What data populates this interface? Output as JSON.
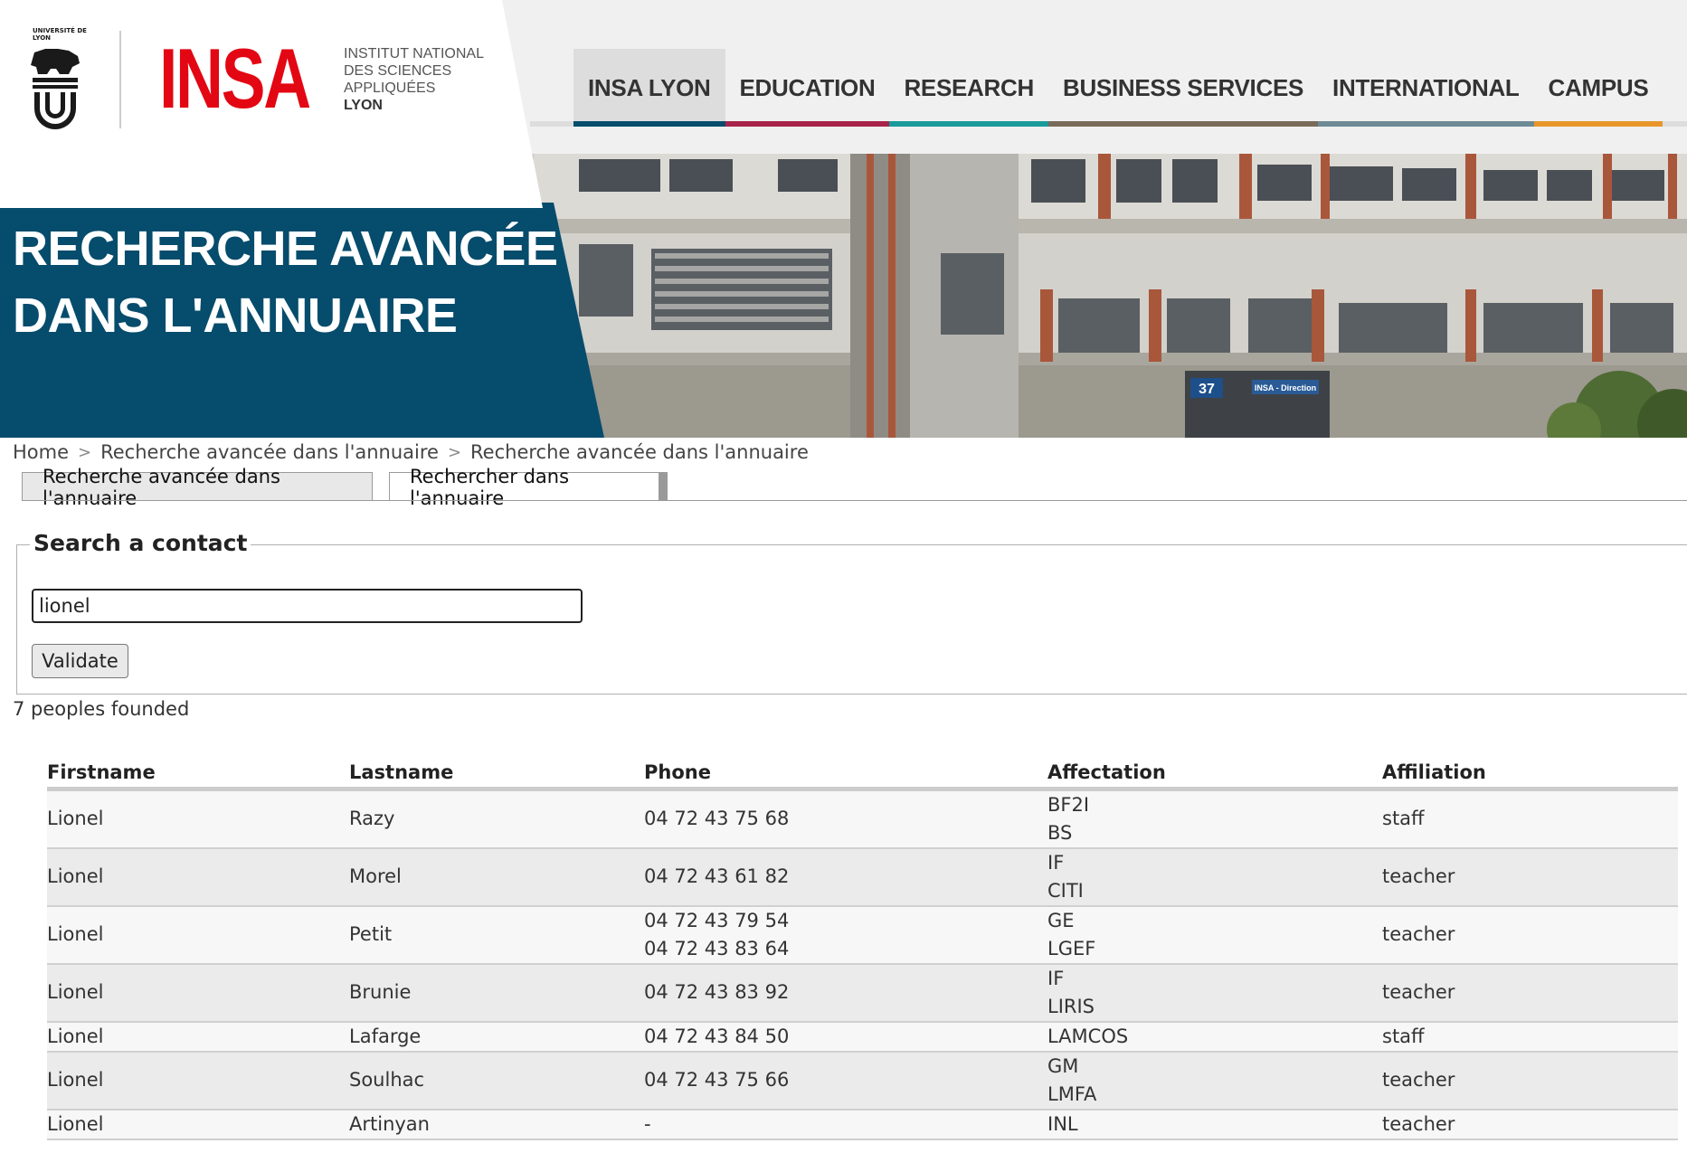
{
  "logo": {
    "university_text": "UNIVERSITÉ DE LYON",
    "brand": "INSA",
    "subtitle_lines": [
      "INSTITUT NATIONAL",
      "DES SCIENCES",
      "APPLIQUÉES"
    ],
    "subtitle_city": "LYON",
    "brand_color": "#e30613"
  },
  "nav": {
    "items": [
      {
        "label": "INSA LYON",
        "color": "#064c6c"
      },
      {
        "label": "EDUCATION",
        "color": "#a8244a"
      },
      {
        "label": "RESEARCH",
        "color": "#1a9a9a"
      },
      {
        "label": "BUSINESS SERVICES",
        "color": "#7a6a5a"
      },
      {
        "label": "INTERNATIONAL",
        "color": "#6d8a95"
      },
      {
        "label": "CAMPUS",
        "color": "#e8962a"
      }
    ]
  },
  "banner": {
    "title_lines": [
      "RECHERCHE AVANCÉE",
      "DANS L'ANNUAIRE"
    ],
    "title_bg": "#064c6c",
    "building_number": "37",
    "building_sign": "INSA - Direction"
  },
  "breadcrumb": {
    "items": [
      "Home",
      "Recherche avancée dans l'annuaire",
      "Recherche avancée dans l'annuaire"
    ],
    "separator": ">"
  },
  "tabs": {
    "advanced": "Recherche avancée dans l'annuaire",
    "search": "Rechercher dans l'annuaire"
  },
  "search": {
    "legend": "Search a contact",
    "value": "lionel",
    "button_label": "Validate"
  },
  "results": {
    "count_text": "7 peoples founded",
    "columns": [
      "Firstname",
      "Lastname",
      "Phone",
      "Affectation",
      "Affiliation"
    ],
    "rows": [
      {
        "firstname": "Lionel",
        "lastname": "Razy",
        "phones": [
          "04 72 43 75 68"
        ],
        "affectations": [
          "BF2I",
          "BS"
        ],
        "affiliation": "staff"
      },
      {
        "firstname": "Lionel",
        "lastname": "Morel",
        "phones": [
          "04 72 43 61 82"
        ],
        "affectations": [
          "IF",
          "CITI"
        ],
        "affiliation": "teacher"
      },
      {
        "firstname": "Lionel",
        "lastname": "Petit",
        "phones": [
          "04 72 43 79 54",
          "04 72 43 83 64"
        ],
        "affectations": [
          "GE",
          "LGEF"
        ],
        "affiliation": "teacher"
      },
      {
        "firstname": "Lionel",
        "lastname": "Brunie",
        "phones": [
          "04 72 43 83 92"
        ],
        "affectations": [
          "IF",
          "LIRIS"
        ],
        "affiliation": "teacher"
      },
      {
        "firstname": "Lionel",
        "lastname": "Lafarge",
        "phones": [
          "04 72 43 84 50"
        ],
        "affectations": [
          "LAMCOS"
        ],
        "affiliation": "staff"
      },
      {
        "firstname": "Lionel",
        "lastname": "Soulhac",
        "phones": [
          "04 72 43 75 66"
        ],
        "affectations": [
          "GM",
          "LMFA"
        ],
        "affiliation": "teacher"
      },
      {
        "firstname": "Lionel",
        "lastname": "Artinyan",
        "phones": [
          "-"
        ],
        "affectations": [
          "INL"
        ],
        "affiliation": "teacher"
      }
    ]
  }
}
